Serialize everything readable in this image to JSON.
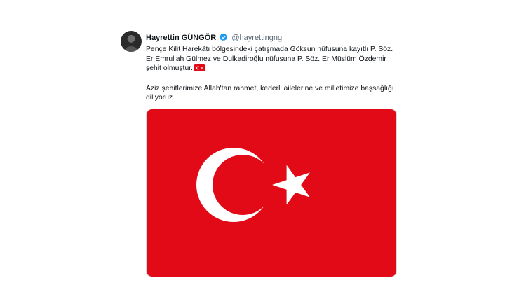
{
  "tweet": {
    "author_name": "Hayrettin GÜNGÖR",
    "author_handle": "@hayrettingng",
    "text_paragraph_1": "Pençe Kilit Harekâtı bölgesindeki çatışmada Göksun nüfusuna kayıtlı P. Söz. Er Emrullah Gülmez ve Dulkadiroğlu nüfusuna P. Söz. Er Müslüm Özdemir şehit olmuştur.",
    "text_paragraph_2": "Aziz şehitlerimize Allah'tan rahmet, kederli ailelerine ve milletimize başsağlığı diliyoruz.",
    "inline_emoji": "turkey-flag-emoji",
    "media_image": "turkey-flag",
    "colors": {
      "flag_red": "#e30a17",
      "verified_blue": "#1d9bf0",
      "handle_gray": "#536471"
    }
  }
}
